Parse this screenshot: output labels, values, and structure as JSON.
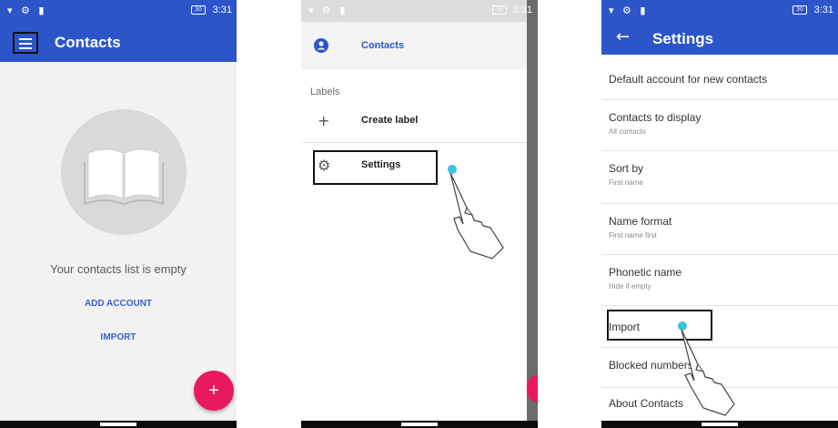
{
  "status_bar": {
    "left_icons": "▾ ⚙ ▮",
    "battery_text": "30",
    "time": "3:31"
  },
  "screen1": {
    "title": "Contacts",
    "empty_message": "Your contacts list is empty",
    "add_account_label": "ADD ACCOUNT",
    "import_label": "IMPORT",
    "fab_symbol": "+"
  },
  "screen2": {
    "header_label": "Contacts",
    "labels_header": "Labels",
    "create_label": "Create label",
    "create_label_icon": "+",
    "settings_label": "Settings",
    "settings_icon": "⚙"
  },
  "screen3": {
    "title": "Settings",
    "back_icon": "←",
    "rows": [
      {
        "title": "Default account for new contacts",
        "subtitle": ""
      },
      {
        "title": "Contacts to display",
        "subtitle": "All contacts"
      },
      {
        "title": "Sort by",
        "subtitle": "First name"
      },
      {
        "title": "Name format",
        "subtitle": "First name first"
      },
      {
        "title": "Phonetic name",
        "subtitle": "Hide if empty"
      },
      {
        "title": "Import",
        "subtitle": ""
      },
      {
        "title": "Blocked numbers",
        "subtitle": ""
      },
      {
        "title": "About Contacts",
        "subtitle": ""
      }
    ]
  },
  "colors": {
    "primary": "#2c55c9",
    "accent": "#e8195e",
    "tap_indicator": "#3cc2d6"
  },
  "icons": [
    "menu-icon",
    "book-icon",
    "account-circle-icon",
    "plus-icon",
    "gear-icon",
    "back-arrow-icon",
    "hand-pointer-icon"
  ]
}
